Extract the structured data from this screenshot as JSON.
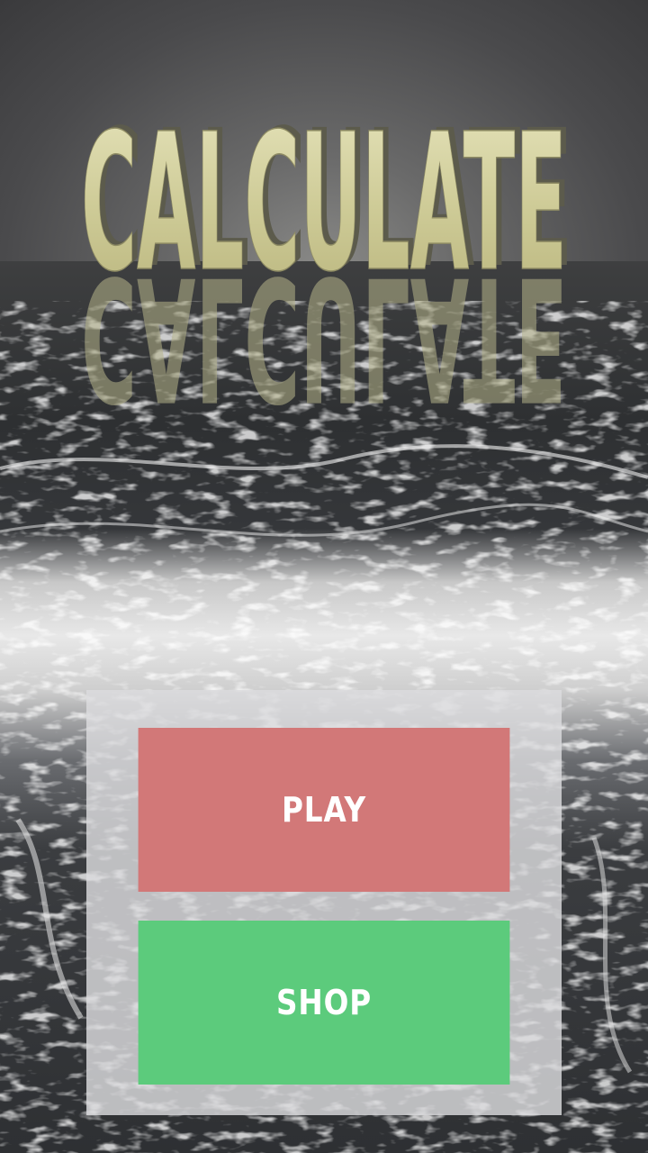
{
  "game": {
    "title": "CALCULATE"
  },
  "menu": {
    "play_label": "PLAY",
    "shop_label": "SHOP"
  },
  "colors": {
    "play_button": "#d27878",
    "shop_button": "#5ccb7c",
    "panel": "#dcdcde",
    "logo_gold": "#d8d6a8"
  }
}
